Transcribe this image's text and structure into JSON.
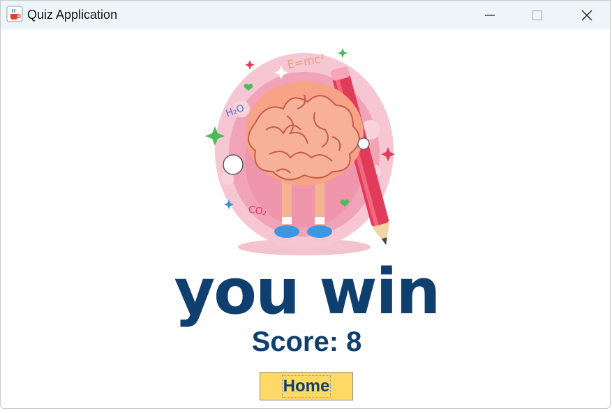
{
  "window": {
    "title": "Quiz Application",
    "icon": "java-cup-icon",
    "controls": [
      "minimize-icon",
      "maximize-icon",
      "close-icon"
    ]
  },
  "illustration": {
    "subject": "brain-with-pencil-illustration",
    "labels": [
      "E=mc²",
      "H₂O",
      "CO₂"
    ]
  },
  "result": {
    "headline": "you win",
    "score_text": "Score: 8"
  },
  "actions": {
    "home_label": "Home"
  },
  "colors": {
    "accent": "#0f3f6e",
    "button_bg": "#ffd966",
    "titlebar_bg": "#eef5f9"
  }
}
